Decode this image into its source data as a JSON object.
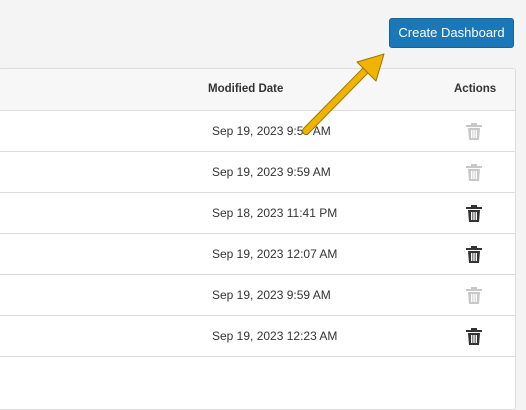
{
  "toolbar": {
    "create_label": "Create Dashboard"
  },
  "table": {
    "columns": {
      "modified": "Modified Date",
      "actions": "Actions"
    },
    "rows": [
      {
        "modified": "Sep 19, 2023 9:59 AM",
        "delete_enabled": false
      },
      {
        "modified": "Sep 19, 2023 9:59 AM",
        "delete_enabled": false
      },
      {
        "modified": "Sep 18, 2023 11:41 PM",
        "delete_enabled": true
      },
      {
        "modified": "Sep 19, 2023 12:07 AM",
        "delete_enabled": true
      },
      {
        "modified": "Sep 19, 2023 9:59 AM",
        "delete_enabled": false
      },
      {
        "modified": "Sep 19, 2023 12:23 AM",
        "delete_enabled": true
      }
    ]
  },
  "colors": {
    "primary": "#1b78b8",
    "annotation_arrow": "#f0b400",
    "icon_enabled": "#333333",
    "icon_disabled": "#c8c8c8"
  },
  "icons": {
    "row_action": "trash-icon",
    "annotation": "arrow-annotation"
  }
}
